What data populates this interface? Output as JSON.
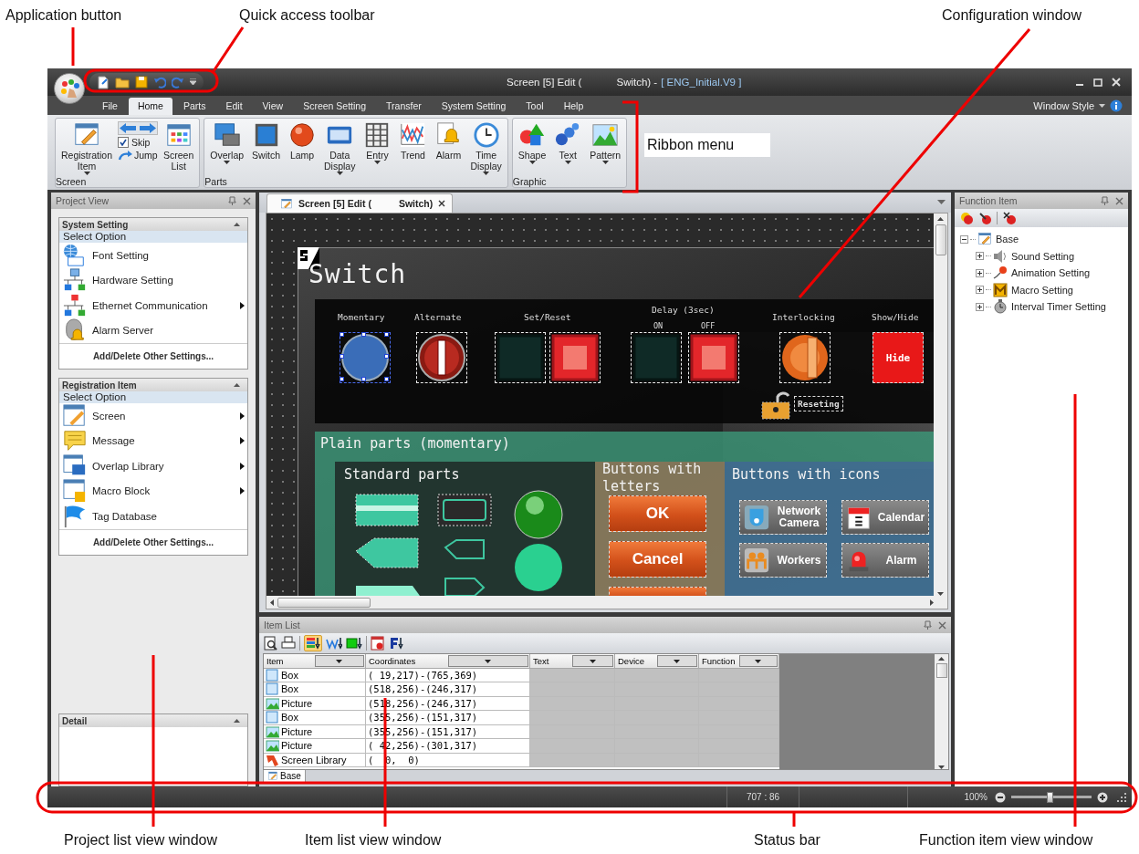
{
  "callouts": [
    {
      "label": "Application button"
    },
    {
      "label": "Quick access toolbar"
    },
    {
      "label": "Configuration window"
    },
    {
      "label": "Ribbon menu"
    },
    {
      "label": "Project list view window"
    },
    {
      "label": "Item list view window"
    },
    {
      "label": "Status bar"
    },
    {
      "label": "Function item view window"
    }
  ],
  "window": {
    "title": "Screen [5] Edit (",
    "title_rest": "Switch) -",
    "file": "[ ENG_Initial.V9 ]"
  },
  "ribbon": {
    "tabs": [
      {
        "label": "File",
        "selected": false
      },
      {
        "label": "Home",
        "selected": true
      },
      {
        "label": "Parts",
        "selected": false
      },
      {
        "label": "Edit",
        "selected": false
      },
      {
        "label": "View",
        "selected": false
      },
      {
        "label": "Screen Setting",
        "selected": false
      },
      {
        "label": "Transfer",
        "selected": false
      },
      {
        "label": "System Setting",
        "selected": false
      },
      {
        "label": "Tool",
        "selected": false
      },
      {
        "label": "Help",
        "selected": false
      }
    ],
    "window_style": "Window Style",
    "groups": [
      {
        "name": "Screen",
        "items": [
          {
            "kind": "large",
            "label": "Registration Item",
            "dropdown": true
          },
          {
            "kind": "nav",
            "skip": {
              "label": "Skip",
              "checked": true
            },
            "jump": "Jump"
          },
          {
            "kind": "large",
            "label": "Screen List",
            "dropdown": false
          }
        ]
      },
      {
        "name": "Parts",
        "items": [
          {
            "kind": "large",
            "label": "Overlap",
            "dropdown": true
          },
          {
            "kind": "large",
            "label": "Switch",
            "dropdown": false
          },
          {
            "kind": "large",
            "label": "Lamp",
            "dropdown": false
          },
          {
            "kind": "large",
            "label": "Data Display",
            "dropdown": true
          },
          {
            "kind": "large",
            "label": "Entry",
            "dropdown": true
          },
          {
            "kind": "large",
            "label": "Trend",
            "dropdown": false
          },
          {
            "kind": "large",
            "label": "Alarm",
            "dropdown": false
          },
          {
            "kind": "large",
            "label": "Time Display",
            "dropdown": true
          }
        ]
      },
      {
        "name": "Graphic",
        "items": [
          {
            "kind": "large",
            "label": "Shape",
            "dropdown": true
          },
          {
            "kind": "large",
            "label": "Text",
            "dropdown": true
          },
          {
            "kind": "large",
            "label": "Pattern",
            "dropdown": true
          }
        ]
      }
    ]
  },
  "project_view": {
    "title": "Project View",
    "sections": [
      {
        "title": "System Setting",
        "subtitle": "Select Option",
        "items": [
          {
            "label": "Font Setting",
            "submenu": false
          },
          {
            "label": "Hardware Setting",
            "submenu": false
          },
          {
            "label": "Ethernet Communication",
            "submenu": true
          },
          {
            "label": "Alarm Server",
            "submenu": false
          }
        ],
        "footer": "Add/Delete Other Settings..."
      },
      {
        "title": "Registration Item",
        "subtitle": "Select Option",
        "items": [
          {
            "label": "Screen",
            "submenu": true
          },
          {
            "label": "Message",
            "submenu": true
          },
          {
            "label": "Overlap Library",
            "submenu": true
          },
          {
            "label": "Macro Block",
            "submenu": true
          },
          {
            "label": "Tag Database",
            "submenu": false
          }
        ],
        "footer": "Add/Delete Other Settings..."
      }
    ],
    "detail": {
      "title": "Detail"
    }
  },
  "editor": {
    "tab": {
      "label": "Screen [5] Edit (",
      "label_rest": "Switch)"
    },
    "canvas": {
      "title": "Switch",
      "groups": [
        {
          "label": "Momentary",
          "parts": [
            {
              "kind": "round-button",
              "selected": true
            }
          ]
        },
        {
          "label": "Alternate",
          "parts": [
            {
              "kind": "toggle-knob",
              "selected": false
            }
          ]
        },
        {
          "label": "Set/Reset",
          "parts": [
            {
              "kind": "dark-square",
              "selected": false
            },
            {
              "kind": "lit-square",
              "selected": false
            }
          ]
        },
        {
          "label": "Delay (3sec)",
          "sublabels": [
            "ON",
            "OFF"
          ],
          "parts": [
            {
              "kind": "dark-square",
              "selected": false
            },
            {
              "kind": "lit-square",
              "selected": false
            }
          ]
        },
        {
          "label": "Interlocking",
          "parts": [
            {
              "kind": "key-switch",
              "selected": false
            }
          ]
        },
        {
          "label": "Show/Hide",
          "parts": [
            {
              "kind": "text-button",
              "text": "Hide",
              "selected": false
            }
          ]
        }
      ],
      "lock_label": "Reseting",
      "plain_title": "Plain parts (momentary)",
      "standard_title": "Standard parts",
      "letters_title": "Buttons with letters",
      "letter_buttons": [
        "OK",
        "Cancel"
      ],
      "icons_title": "Buttons with icons",
      "icon_buttons": [
        "Network Camera",
        "Calendar",
        "Workers",
        "Alarm"
      ]
    }
  },
  "item_list": {
    "title": "Item List",
    "columns": [
      "Item",
      "Coordinates",
      "Text",
      "Device",
      "Function"
    ],
    "rows": [
      {
        "kind": "box",
        "item": "Box",
        "coordinates": "( 19,217)-(765,369)"
      },
      {
        "kind": "box",
        "item": "Box",
        "coordinates": "(518,256)-(246,317)"
      },
      {
        "kind": "picture",
        "item": "Picture",
        "coordinates": "(518,256)-(246,317)"
      },
      {
        "kind": "box",
        "item": "Box",
        "coordinates": "(355,256)-(151,317)"
      },
      {
        "kind": "picture",
        "item": "Picture",
        "coordinates": "(355,256)-(151,317)"
      },
      {
        "kind": "picture",
        "item": "Picture",
        "coordinates": "( 42,256)-(301,317)"
      },
      {
        "kind": "library",
        "item": "Screen Library",
        "coordinates": "(  0,  0)"
      }
    ],
    "tabs": [
      {
        "label": "Base",
        "selected": true
      }
    ]
  },
  "function_item": {
    "title": "Function Item",
    "tree": [
      {
        "label": "Base",
        "expanded": true,
        "children": [
          {
            "label": "Sound Setting",
            "expanded": false
          },
          {
            "label": "Animation Setting",
            "expanded": false
          },
          {
            "label": "Macro Setting",
            "expanded": false
          },
          {
            "label": "Interval Timer Setting",
            "expanded": false
          }
        ]
      }
    ]
  },
  "status_bar": {
    "position": "707 : 86",
    "zoom": {
      "reading": "100%",
      "level": 0.48
    }
  }
}
